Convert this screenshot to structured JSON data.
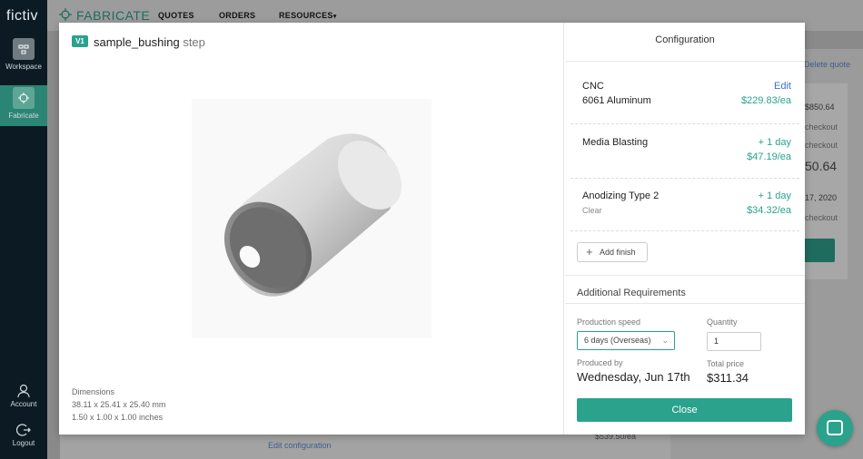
{
  "app": {
    "brand": "fictiv",
    "logo_text": "FABRICATE",
    "nav": [
      "QUOTES",
      "ORDERS",
      "RESOURCES"
    ]
  },
  "rail": {
    "workspace_label": "Workspace",
    "fabricate_label": "Fabricate",
    "account_label": "Account",
    "logout_label": "Logout"
  },
  "background_page": {
    "delete_quote": "Delete quote",
    "price_1": "$850.64",
    "checkout_1": "checkout",
    "checkout_2": "checkout",
    "price_2": "50.64",
    "date": "17, 2020",
    "checkout_3": "checkout",
    "edit_configuration": "Edit configuration",
    "price_3": "$539.50/ea"
  },
  "viewer": {
    "version_badge": "V1",
    "file_name": "sample_bushing",
    "file_ext": "step",
    "dimensions_title": "Dimensions",
    "dimensions_mm": "38.11 x 25.41 x 25.40 mm",
    "dimensions_in": "1.50 x 1.00 x 1.00 inches"
  },
  "config": {
    "title": "Configuration",
    "process": {
      "name": "CNC",
      "material": "6061 Aluminum",
      "edit_label": "Edit",
      "price": "$229.83/ea"
    },
    "finishes": [
      {
        "name": "Media Blasting",
        "sub": "",
        "lead": "+ 1 day",
        "price": "$47.19/ea"
      },
      {
        "name": "Anodizing Type 2",
        "sub": "Clear",
        "lead": "+ 1 day",
        "price": "$34.32/ea"
      }
    ],
    "add_finish_label": "Add finish",
    "additional_title": "Additional Requirements",
    "production_speed_label": "Production speed",
    "production_speed_value": "6 days (Overseas)",
    "quantity_label": "Quantity",
    "quantity_value": "1",
    "produced_by_label": "Produced by",
    "produced_by_value": "Wednesday, Jun 17th",
    "total_label": "Total price",
    "total_value": "$311.34",
    "close_label": "Close"
  },
  "colors": {
    "accent": "#2aa28c",
    "rail": "#0c1b23",
    "link": "#3b73c6"
  }
}
